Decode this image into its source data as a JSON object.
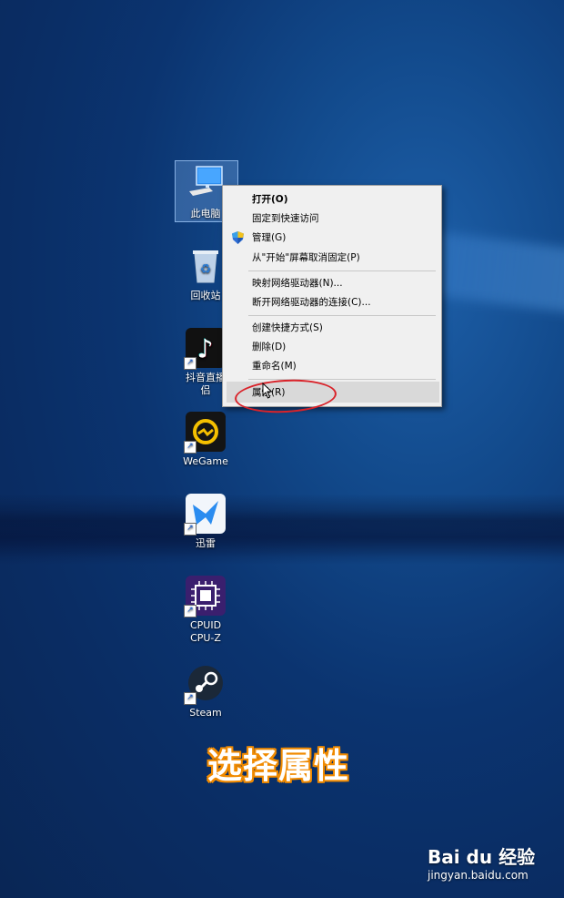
{
  "desktop": {
    "icons": [
      {
        "label": "此电脑",
        "icon": "this-pc-icon"
      },
      {
        "label": "回收站",
        "icon": "recycle-bin-icon"
      },
      {
        "label": "抖音直播伴侣",
        "label_line1": "抖音直播",
        "label_line2": "侣",
        "icon": "douyin-icon"
      },
      {
        "label": "WeGame",
        "icon": "wegame-icon"
      },
      {
        "label": "迅雷",
        "icon": "xunlei-icon"
      },
      {
        "label_line1": "CPUID",
        "label_line2": "CPU-Z",
        "icon": "cpuz-icon"
      },
      {
        "label": "Steam",
        "icon": "steam-icon"
      }
    ]
  },
  "context_menu": {
    "items": [
      {
        "label": "打开(O)",
        "bold": true
      },
      {
        "label": "固定到快速访问"
      },
      {
        "label": "管理(G)",
        "icon": "uac-shield-icon"
      },
      {
        "label": "从\"开始\"屏幕取消固定(P)"
      },
      {
        "label": "映射网络驱动器(N)..."
      },
      {
        "label": "断开网络驱动器的连接(C)..."
      },
      {
        "label": "创建快捷方式(S)"
      },
      {
        "label": "删除(D)"
      },
      {
        "label": "重命名(M)"
      },
      {
        "label": "属性(R)",
        "highlighted": true
      }
    ]
  },
  "caption": "选择属性",
  "watermark": {
    "brand": "Bai du 经验",
    "url": "jingyan.baidu.com"
  },
  "colors": {
    "caption_outline": "#f08a00",
    "annotation_circle": "#d9232a",
    "desktop_blue": "#0b3470"
  }
}
